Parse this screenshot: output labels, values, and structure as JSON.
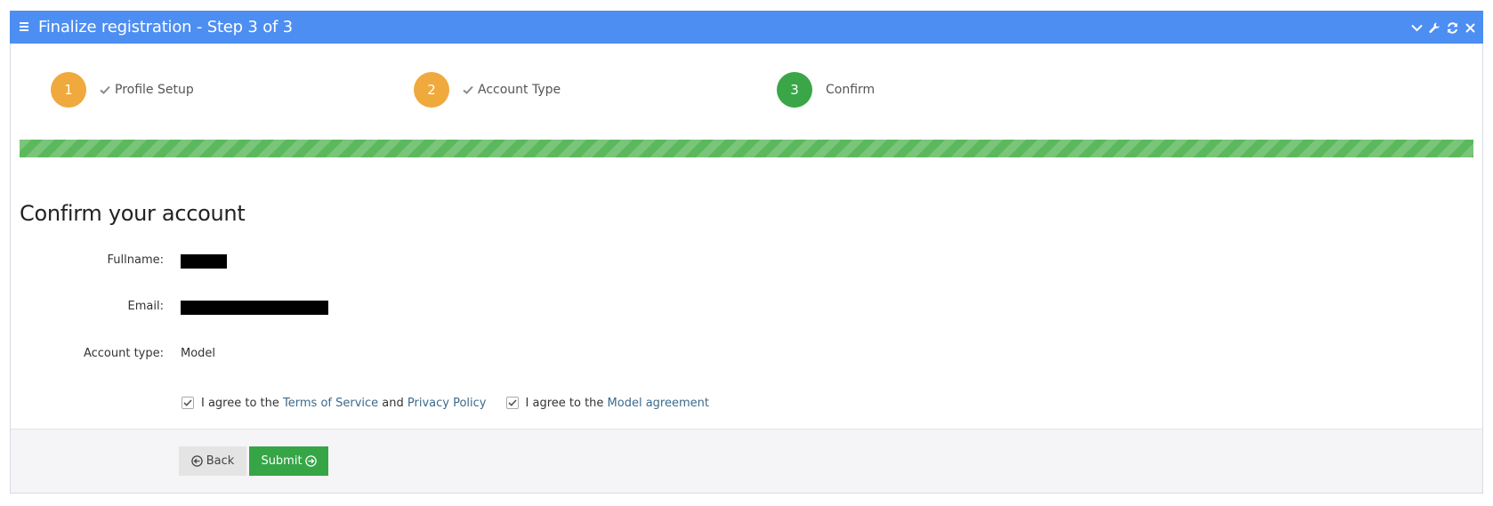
{
  "header": {
    "title": "Finalize registration - Step 3 of 3",
    "menu_icon": "hamburger-icon",
    "tools": [
      {
        "name": "collapse",
        "icon": "chevron-down-icon"
      },
      {
        "name": "settings",
        "icon": "wrench-icon"
      },
      {
        "name": "refresh",
        "icon": "refresh-icon"
      },
      {
        "name": "close",
        "icon": "close-icon"
      }
    ]
  },
  "steps": [
    {
      "number": "1",
      "label": "Profile Setup",
      "completed": true,
      "color": "#f0a93c"
    },
    {
      "number": "2",
      "label": "Account Type",
      "completed": true,
      "color": "#f0a93c"
    },
    {
      "number": "3",
      "label": "Confirm",
      "completed": false,
      "color": "#3aa648"
    }
  ],
  "progress": {
    "percent": 100,
    "color": "#5cb85c"
  },
  "confirm": {
    "title": "Confirm your account",
    "fields": [
      {
        "label": "Fullname:",
        "value": "[redacted]",
        "redacted": true
      },
      {
        "label": "Email:",
        "value": "[redacted]",
        "redacted": true
      },
      {
        "label": "Account type:",
        "value": "Model",
        "redacted": false
      }
    ],
    "agreements": [
      {
        "checked": true,
        "prefix": "I agree to the",
        "link1": "Terms of Service",
        "middle": "and",
        "link2": "Privacy Policy"
      },
      {
        "checked": true,
        "prefix": "I agree to the",
        "link1": "Model agreement"
      }
    ]
  },
  "footer": {
    "back_label": "Back",
    "submit_label": "Submit"
  },
  "colors": {
    "header_bg": "#4d8ef2",
    "link": "#3b6a8c",
    "submit_bg": "#36a546",
    "back_bg": "#e4e4e4"
  }
}
